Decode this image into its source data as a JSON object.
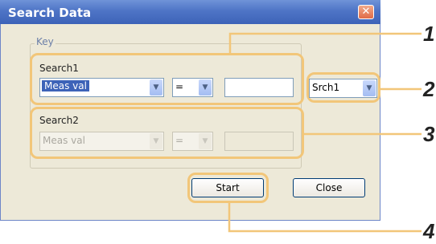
{
  "window": {
    "title": "Search Data",
    "close_icon": "close-icon"
  },
  "key_group": {
    "label": "Key"
  },
  "search1": {
    "label": "Search1",
    "field": "Meas val",
    "operator": "=",
    "value": ""
  },
  "search2": {
    "label": "Search2",
    "field": "Meas val",
    "operator": "=",
    "value": ""
  },
  "search_select": {
    "value": "Srch1"
  },
  "buttons": {
    "start": "Start",
    "close": "Close"
  },
  "callouts": [
    "1",
    "2",
    "3",
    "4"
  ],
  "colors": {
    "titlebar": "#4e74c6",
    "highlight": "#f2c679",
    "dialog_bg": "#ede9d8",
    "selection": "#3d63b8"
  }
}
